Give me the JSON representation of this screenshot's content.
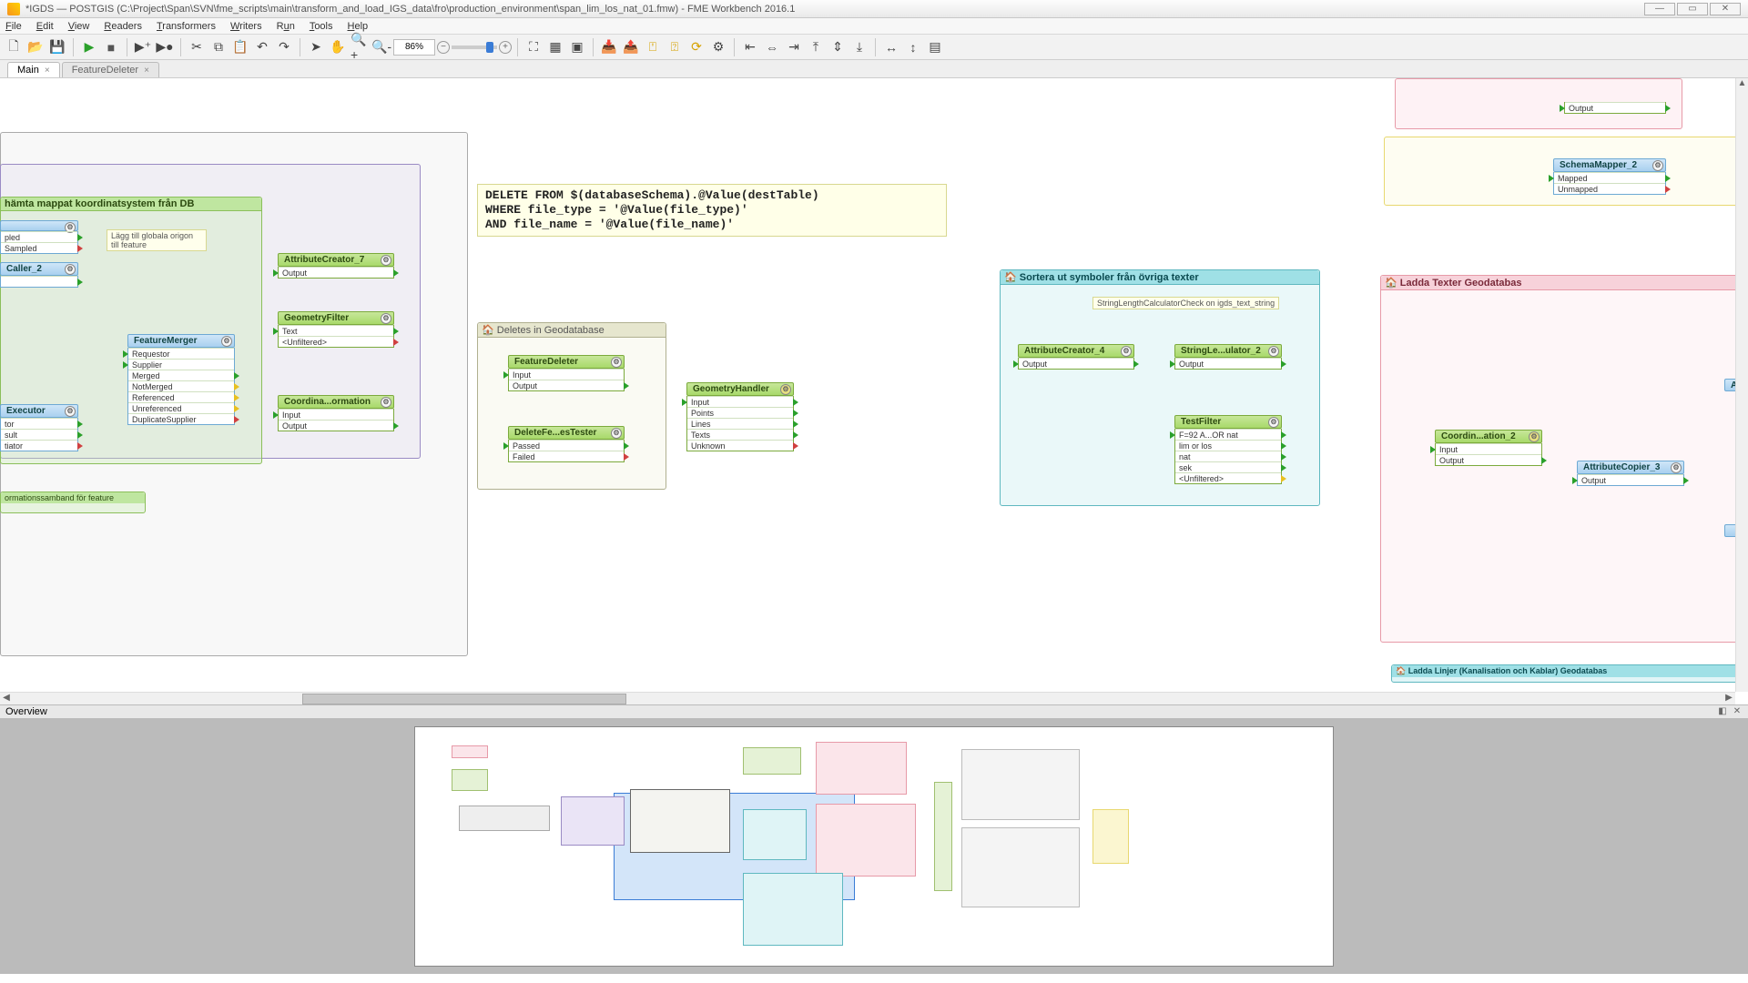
{
  "window": {
    "title": "*IGDS — POSTGIS (C:\\Project\\Span\\SVN\\fme_scripts\\main\\transform_and_load_IGS_data\\fro\\production_environment\\span_lim_los_nat_01.fmw) - FME Workbench 2016.1"
  },
  "menu": {
    "items": [
      "File",
      "Edit",
      "View",
      "Readers",
      "Transformers",
      "Writers",
      "Run",
      "Tools",
      "Help"
    ]
  },
  "toolbar": {
    "zoom": "86%"
  },
  "tabs": {
    "main": "Main",
    "t2": "FeatureDeleter"
  },
  "annotation": {
    "sql": "DELETE FROM $(databaseSchema).@Value(destTable)\nWHERE file_type = '@Value(file_type)'\nAND file_name = '@Value(file_name)'"
  },
  "bookmarks": {
    "bm_left_top": "hämta mappat koordinatsystem från DB",
    "bm_left_note": "Lägg till globala origon\ntill feature",
    "bm_left_bottom": "ormationssamband för feature",
    "bm_deletes": "Deletes in Geodatabase",
    "bm_sortera": "Sortera ut symboler från övriga texter",
    "bm_sortera_note": "StringLengthCalculatorCheck on igds_text_string",
    "bm_ladda": "Ladda Texter Geodatabas",
    "bm_ladda2": "Ladda Linjer (Kanalisation och Kablar) Geodatabas"
  },
  "nodes": {
    "ac7": {
      "title": "AttributeCreator_7",
      "ports": [
        "Output"
      ]
    },
    "geomfilter": {
      "title": "GeometryFilter",
      "ports": [
        "Text",
        "<Unfiltered>"
      ]
    },
    "coordxf": {
      "title": "Coordina...ormation",
      "ports": [
        "Input",
        "Output"
      ]
    },
    "featuremerger": {
      "title": "FeatureMerger",
      "ports": [
        "Requestor",
        "Supplier",
        "Merged",
        "NotMerged",
        "Referenced",
        "Unreferenced",
        "DuplicateSupplier"
      ]
    },
    "sampled": {
      "ports": [
        "pled",
        "Sampled"
      ]
    },
    "caller2": {
      "title": "Caller_2",
      "ports": [
        ""
      ]
    },
    "executor": {
      "title": "Executor",
      "ports": [
        "tor",
        "sult",
        "tiator"
      ]
    },
    "featuredeleter": {
      "title": "FeatureDeleter",
      "ports": [
        "Input",
        "Output"
      ]
    },
    "deltest": {
      "title": "DeleteFe...esTester",
      "ports": [
        "Passed",
        "Failed"
      ]
    },
    "geomhandler": {
      "title": "GeometryHandler",
      "ports": [
        "Input",
        "Points",
        "Lines",
        "Texts",
        "Unknown"
      ]
    },
    "ac4": {
      "title": "AttributeCreator_4",
      "ports": [
        "Output"
      ]
    },
    "strlen": {
      "title": "StringLe...ulator_2",
      "ports": [
        "Output"
      ]
    },
    "testfilter": {
      "title": "TestFilter",
      "ports": [
        "F=92 A...OR nat",
        "lim or los",
        "nat",
        "sek",
        "<Unfiltered>"
      ]
    },
    "coordaltion": {
      "title": "Coordin...ation_2",
      "ports": [
        "Input",
        "Output"
      ]
    },
    "attrcopier": {
      "title": "AttributeCopier_3",
      "ports": [
        "Output"
      ]
    },
    "schemamapper": {
      "title": "SchemaMapper_2",
      "ports": [
        "Mapped",
        "Unmapped"
      ]
    },
    "outport": {
      "ports": [
        "Output"
      ]
    }
  },
  "overview": {
    "title": "Overview"
  }
}
